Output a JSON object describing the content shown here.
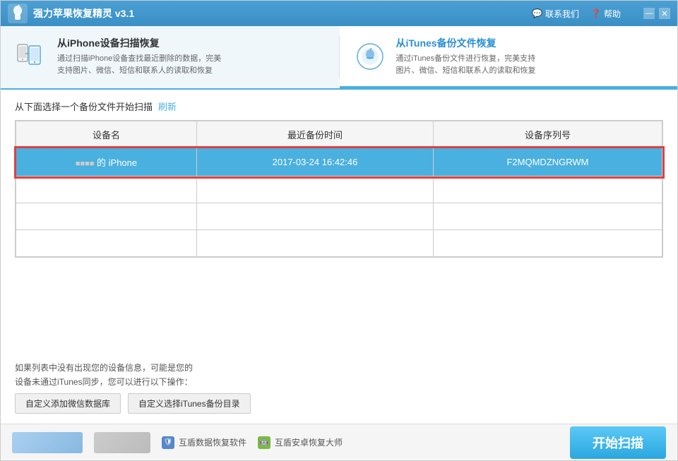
{
  "titlebar": {
    "logo_alt": "app-logo",
    "title": "强力苹果恢复精灵 v3.1",
    "contact_label": "联系我们",
    "help_label": "帮助",
    "minimize_label": "—",
    "close_label": "✕"
  },
  "tabs": [
    {
      "id": "iphone-scan",
      "label": "从iPhone设备扫描恢复",
      "description": "通过扫描iPhone设备查找最近删除的数据，完美\n支持图片、微信、短信和联系人的读取和恢复",
      "active": false,
      "icon_type": "iphone"
    },
    {
      "id": "itunes-restore",
      "label": "从iTunes备份文件恢复",
      "description": "通过iTunes备份文件进行恢复，完美支持\n图片、微信、短信和联系人的读取和恢复",
      "active": true,
      "icon_type": "itunes"
    }
  ],
  "section_title": "从下面选择一个备份文件开始扫描",
  "refresh_label": "刷新",
  "table": {
    "columns": [
      "设备名",
      "最近备份时间",
      "设备序列号"
    ],
    "rows": [
      {
        "device": "的 iPhone",
        "time": "2017-03-24 16:42:46",
        "serial": "F2MQMDZNGRWM",
        "selected": true
      },
      {
        "device": "",
        "time": "",
        "serial": "",
        "selected": false
      },
      {
        "device": "",
        "time": "",
        "serial": "",
        "selected": false
      },
      {
        "device": "",
        "time": "",
        "serial": "",
        "selected": false
      }
    ]
  },
  "bottom_info": {
    "line1": "如果列表中没有出现您的设备信息，可能是您的",
    "line2": "设备未通过iTunes同步，您可以进行以下操作："
  },
  "action_buttons": [
    {
      "label": "自定义添加微信数据库"
    },
    {
      "label": "自定义选择iTunes备份目录"
    }
  ],
  "footer": {
    "logo_items": [
      {
        "type": "image",
        "label": ""
      },
      {
        "type": "image",
        "label": ""
      },
      {
        "type": "shield",
        "label": "互盾数据恢复软件"
      },
      {
        "type": "android",
        "label": "互盾安卓恢复大师"
      }
    ],
    "start_button": "开始扫描"
  }
}
